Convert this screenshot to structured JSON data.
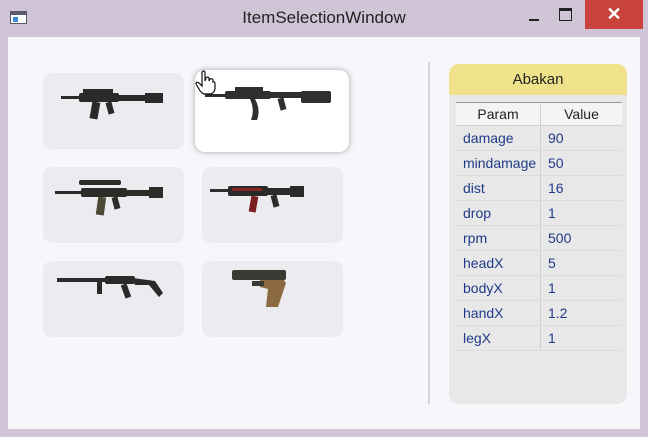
{
  "window": {
    "title": "ItemSelectionWindow",
    "close_glyph": "✕"
  },
  "items": [
    {
      "name": "assault-rifle-1",
      "icon": "assault-rifle-icon",
      "selected": false
    },
    {
      "name": "ak-rifle",
      "icon": "ak-rifle-icon",
      "selected": true
    },
    {
      "name": "scoped-rifle",
      "icon": "scoped-rifle-icon",
      "selected": false
    },
    {
      "name": "red-rifle",
      "icon": "red-rifle-icon",
      "selected": false
    },
    {
      "name": "carbine",
      "icon": "carbine-icon",
      "selected": false
    },
    {
      "name": "pistol",
      "icon": "pistol-icon",
      "selected": false
    }
  ],
  "details": {
    "title": "Abakan",
    "header_color": "#f0e28a",
    "columns": {
      "param": "Param",
      "value": "Value"
    },
    "rows": [
      {
        "param": "damage",
        "value": "90"
      },
      {
        "param": "mindamage",
        "value": "50"
      },
      {
        "param": "dist",
        "value": "16"
      },
      {
        "param": "drop",
        "value": "1"
      },
      {
        "param": "rpm",
        "value": "500"
      },
      {
        "param": "headX",
        "value": "5"
      },
      {
        "param": "bodyX",
        "value": "1"
      },
      {
        "param": "handX",
        "value": "1.2"
      },
      {
        "param": "legX",
        "value": "1"
      }
    ]
  }
}
